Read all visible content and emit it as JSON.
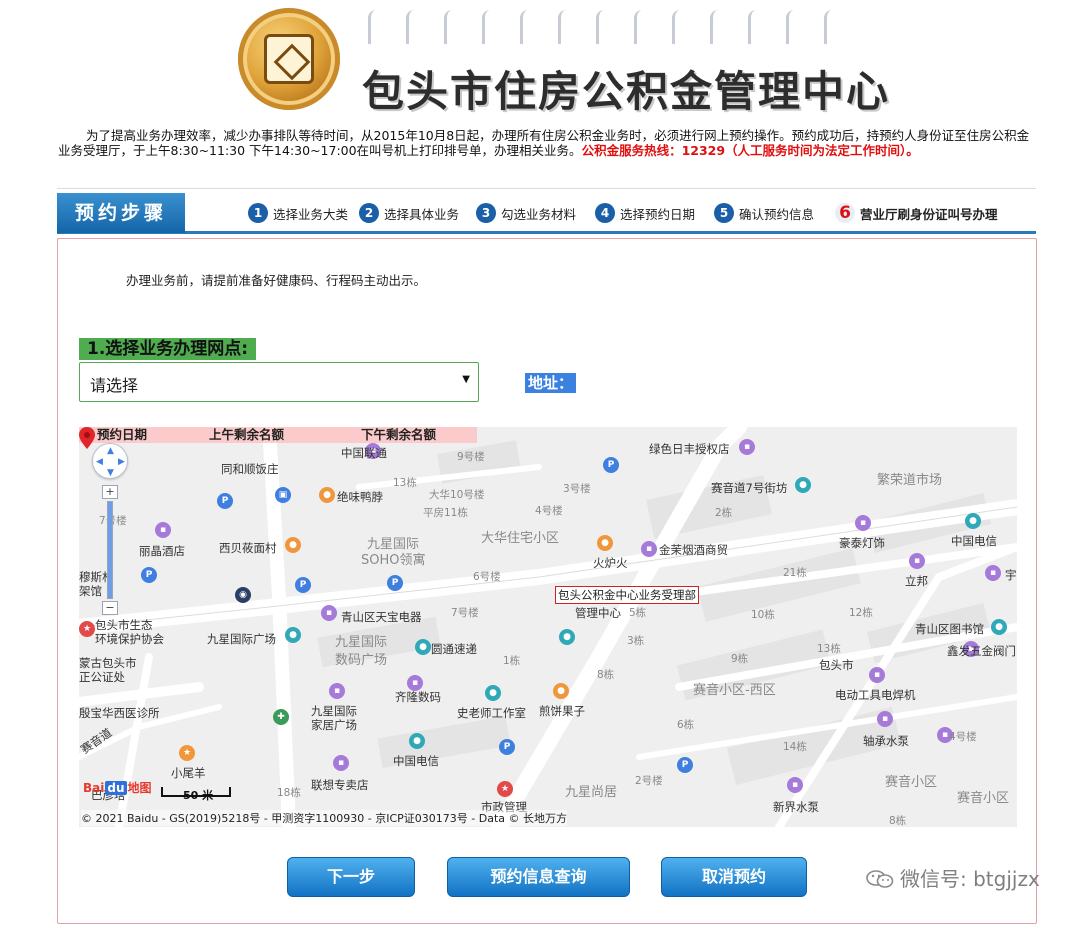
{
  "header": {
    "site_title": "包头市住房公积金管理中心"
  },
  "notice": {
    "text": "为了提高业务办理效率，减少办事排队等待时间，从2015年10月8日起，办理所有住房公积金业务时，必须进行网上预约操作。预约成功后，持预约人身份证至住房公积金业务受理厅，于上午8:30~11:30 下午14:30~17:00在叫号机上打印排号单，办理相关业务。",
    "hotline": "公积金服务热线：12329（人工服务时间为法定工作时间）。"
  },
  "steps": {
    "label": "预约步骤",
    "items": [
      {
        "num": "1",
        "label": "选择业务大类"
      },
      {
        "num": "2",
        "label": "选择具体业务"
      },
      {
        "num": "3",
        "label": "勾选业务材料"
      },
      {
        "num": "4",
        "label": "选择预约日期"
      },
      {
        "num": "5",
        "label": "确认预约信息"
      },
      {
        "num": "6",
        "label": "营业厅刷身份证叫号办理"
      }
    ]
  },
  "main": {
    "tip": "办理业务前，请提前准备好健康码、行程码主动出示。",
    "section_title": "1.选择业务办理网点:",
    "branch_select": {
      "value": "请选择"
    },
    "address_label": "地址："
  },
  "table_head": {
    "date": "预约日期",
    "am_remaining": "上午剩余名额",
    "pm_remaining": "下午剩余名额"
  },
  "map": {
    "marker_label": "包头公积金中心业务受理部",
    "marker_sub": "管理中心",
    "scale": "50 米",
    "logo_text_1": "Bai",
    "logo_text_2": "du",
    "logo_text_3": "地图",
    "copyright": "© 2021 Baidu - GS(2019)5218号 - 甲测资字1100930 - 京ICP证030173号 - Data © 长地万方",
    "zoom_in": "+",
    "zoom_out": "−",
    "labels": [
      {
        "t": "中国联通",
        "c": "dark"
      },
      {
        "t": "9号楼",
        "c": "num"
      },
      {
        "t": "同和顺饭庄",
        "c": "dark"
      },
      {
        "t": "13栋",
        "c": "num"
      },
      {
        "t": "绝味鸭脖",
        "c": "dark"
      },
      {
        "t": "大华10号楼",
        "c": "num"
      },
      {
        "t": "平房11栋",
        "c": "num"
      },
      {
        "t": "3号楼",
        "c": "num"
      },
      {
        "t": "4号楼",
        "c": "num"
      },
      {
        "t": "丽晶酒店",
        "c": "dark"
      },
      {
        "t": "西贝莜面村",
        "c": "dark"
      },
      {
        "t": "九星国际",
        "c": "big"
      },
      {
        "t": "SOHO领寓",
        "c": "big"
      },
      {
        "t": "大华住宅小区",
        "c": "big"
      },
      {
        "t": "6号楼",
        "c": "num"
      },
      {
        "t": "火炉火",
        "c": "dark"
      },
      {
        "t": "金茉烟酒商贸",
        "c": "dark"
      },
      {
        "t": "绿色日丰授权店",
        "c": "dark"
      },
      {
        "t": "赛音道7号街坊",
        "c": "dark"
      },
      {
        "t": "繁荣道市场",
        "c": "big"
      },
      {
        "t": "2栋",
        "c": "num"
      },
      {
        "t": "豪泰灯饰",
        "c": "dark"
      },
      {
        "t": "中国电信",
        "c": "dark"
      },
      {
        "t": "立邦",
        "c": "dark"
      },
      {
        "t": "21栋",
        "c": "num"
      },
      {
        "t": "穆斯林",
        "c": "dark"
      },
      {
        "t": "架馆",
        "c": "dark"
      },
      {
        "t": "青山区天宝电器",
        "c": "dark"
      },
      {
        "t": "7号楼",
        "c": "num"
      },
      {
        "t": "10栋",
        "c": "num"
      },
      {
        "t": "12栋",
        "c": "num"
      },
      {
        "t": "青山区图书馆",
        "c": "dark"
      },
      {
        "t": "包头市生态",
        "c": "dark"
      },
      {
        "t": "环境保护协会",
        "c": "dark"
      },
      {
        "t": "九星国际广场",
        "c": "dark"
      },
      {
        "t": "九星国际",
        "c": "big"
      },
      {
        "t": "数码广场",
        "c": "big"
      },
      {
        "t": "圆通速递",
        "c": "dark"
      },
      {
        "t": "5栋",
        "c": "num"
      },
      {
        "t": "3栋",
        "c": "num"
      },
      {
        "t": "13栋",
        "c": "num"
      },
      {
        "t": "鑫发五金阀门",
        "c": "dark"
      },
      {
        "t": "蒙古包头市",
        "c": "dark"
      },
      {
        "t": "正公证处",
        "c": "dark"
      },
      {
        "t": "1栋",
        "c": "num"
      },
      {
        "t": "9栋",
        "c": "num"
      },
      {
        "t": "包头市",
        "c": "dark"
      },
      {
        "t": "8栋",
        "c": "num"
      },
      {
        "t": "赛音小区-西区",
        "c": "big"
      },
      {
        "t": "齐隆数码",
        "c": "dark"
      },
      {
        "t": "电动工具电焊机",
        "c": "dark"
      },
      {
        "t": "殷宝华西医诊所",
        "c": "dark"
      },
      {
        "t": "九星国际",
        "c": "dark"
      },
      {
        "t": "家居广场",
        "c": "dark"
      },
      {
        "t": "史老师工作室",
        "c": "dark"
      },
      {
        "t": "煎饼果子",
        "c": "dark"
      },
      {
        "t": "6栋",
        "c": "num"
      },
      {
        "t": "轴承水泵",
        "c": "dark"
      },
      {
        "t": "14栋",
        "c": "num"
      },
      {
        "t": "4号楼",
        "c": "num"
      },
      {
        "t": "中国电信",
        "c": "dark"
      },
      {
        "t": "小尾羊",
        "c": "dark"
      },
      {
        "t": "18栋",
        "c": "num"
      },
      {
        "t": "联想专卖店",
        "c": "dark"
      },
      {
        "t": "九星尚居",
        "c": "big"
      },
      {
        "t": "2号楼",
        "c": "num"
      },
      {
        "t": "赛音小区",
        "c": "big"
      },
      {
        "t": "新界水泵",
        "c": "dark"
      },
      {
        "t": "赛音小区",
        "c": "big"
      },
      {
        "t": "市政管理",
        "c": "dark"
      },
      {
        "t": "7号楼",
        "c": "num"
      },
      {
        "t": "宇",
        "c": "dark"
      },
      {
        "t": "巴彦塔",
        "c": "dark"
      },
      {
        "t": "8栋",
        "c": "num"
      },
      {
        "t": "赛音道",
        "c": "dark"
      }
    ]
  },
  "buttons": {
    "next": "下一步",
    "query": "预约信息查询",
    "cancel": "取消预约"
  },
  "watermark": {
    "text": "微信号: btgjjzx"
  }
}
